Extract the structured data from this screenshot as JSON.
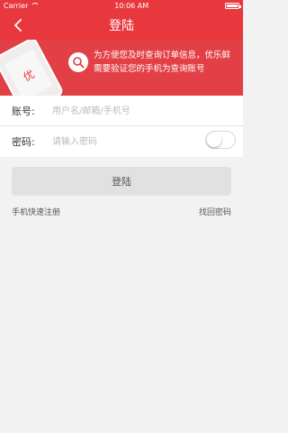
{
  "status_bar": {
    "carrier": "Carrier",
    "time": "10:06 AM"
  },
  "nav": {
    "title": "登陆"
  },
  "banner": {
    "phone_glyph": "优",
    "text": "为方便您及时查询订单信息，优乐鲜需要验证您的手机为查询账号"
  },
  "form": {
    "account_label": "账号:",
    "account_placeholder": "用户名/邮箱/手机号",
    "password_label": "密码:",
    "password_placeholder": "请输入密码",
    "show_password": false
  },
  "actions": {
    "login": "登陆",
    "register": "手机快速注册",
    "forgot": "找回密码"
  },
  "colors": {
    "brand": "#e8383d"
  }
}
